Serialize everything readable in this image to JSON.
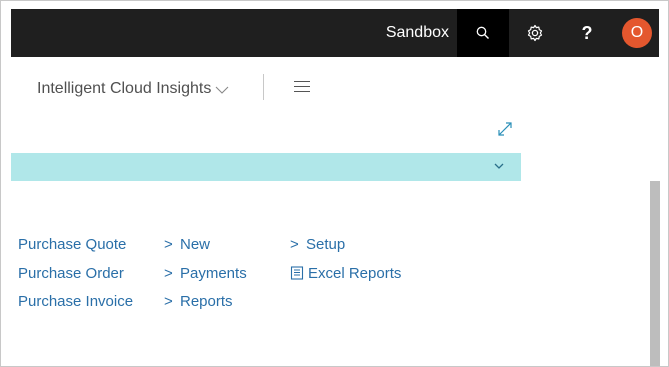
{
  "header": {
    "environment": "Sandbox",
    "avatar_initial": "O",
    "avatar_color": "#e4572e",
    "icons": [
      "search-icon",
      "gear-icon",
      "help-icon"
    ]
  },
  "company": {
    "name": "Intelligent Cloud Insights"
  },
  "links": {
    "col1": [
      "Purchase Quote",
      "Purchase Order",
      "Purchase Invoice"
    ],
    "col2": [
      "New",
      "Payments",
      "Reports"
    ],
    "col3": [
      "Setup",
      "Excel Reports"
    ]
  },
  "colors": {
    "topbar": "#1f1f1f",
    "teal_bar": "#b0e7e9",
    "link": "#2a6fa8"
  }
}
